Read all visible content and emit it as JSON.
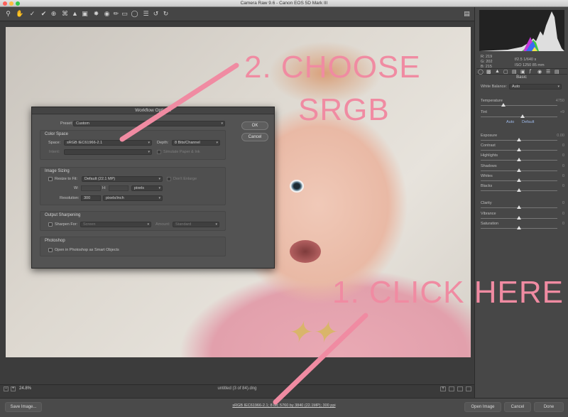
{
  "window": {
    "title": "Camera Raw 9.6  -  Canon EOS 5D Mark III"
  },
  "toolbar": {
    "tools": [
      "zoom-icon",
      "hand-icon",
      "white-balance-icon",
      "color-sampler-icon",
      "target-adjust-icon",
      "crop-icon",
      "straighten-icon",
      "transform-icon",
      "spot-removal-icon",
      "red-eye-icon",
      "adjustment-brush-icon",
      "graduated-filter-icon",
      "radial-filter-icon",
      "preferences-icon",
      "rotate-ccw-icon",
      "rotate-cw-icon"
    ]
  },
  "histogram_readout": {
    "r": "R:  219",
    "g": "G:  202",
    "b": "B:  215",
    "aperture_shutter": "f/2.5    1/640 s",
    "iso_focal": "ISO 1250   85 mm"
  },
  "basic_panel": {
    "title": "Basic",
    "white_balance_label": "White Balance:",
    "white_balance_value": "Auto",
    "auto_link": "Auto",
    "default_link": "Default",
    "sliders": [
      {
        "name": "temperature",
        "label": "Temperature",
        "value": "4750",
        "pos": 0.3
      },
      {
        "name": "tint",
        "label": "Tint",
        "value": "+9",
        "pos": 0.55
      },
      {
        "name": "exposure",
        "label": "Exposure",
        "value": "0.00",
        "pos": 0.5
      },
      {
        "name": "contrast",
        "label": "Contrast",
        "value": "0",
        "pos": 0.5
      },
      {
        "name": "highlights",
        "label": "Highlights",
        "value": "0",
        "pos": 0.5
      },
      {
        "name": "shadows",
        "label": "Shadows",
        "value": "0",
        "pos": 0.5
      },
      {
        "name": "whites",
        "label": "Whites",
        "value": "0",
        "pos": 0.5
      },
      {
        "name": "blacks",
        "label": "Blacks",
        "value": "0",
        "pos": 0.5
      },
      {
        "name": "clarity",
        "label": "Clarity",
        "value": "0",
        "pos": 0.5
      },
      {
        "name": "vibrance",
        "label": "Vibrance",
        "value": "0",
        "pos": 0.5
      },
      {
        "name": "saturation",
        "label": "Saturation",
        "value": "0",
        "pos": 0.5
      }
    ]
  },
  "statusbar": {
    "zoom": "24.8%",
    "filename": "untitled (3 of 84).dng"
  },
  "bottombar": {
    "save_image": "Save Image...",
    "workflow_link": "sRGB IEC61966-2.1; 8 bit; 5760 by 3840 (22.1MP); 300 ppi",
    "open_image": "Open Image",
    "cancel": "Cancel",
    "done": "Done"
  },
  "workflow_dialog": {
    "title": "Workflow Options",
    "preset_label": "Preset:",
    "preset_value": "Custom",
    "ok": "OK",
    "cancel": "Cancel",
    "color_space": {
      "title": "Color Space",
      "space_label": "Space:",
      "space_value": "sRGB IEC61966-2.1",
      "depth_label": "Depth:",
      "depth_value": "8 Bits/Channel",
      "intent_label": "Intent:",
      "simulate_label": "Simulate Paper & Ink"
    },
    "image_sizing": {
      "title": "Image Sizing",
      "resize_label": "Resize to Fit:",
      "resize_value": "Default  (22.1 MP)",
      "dont_enlarge": "Don't Enlarge",
      "w_label": "W:",
      "h_label": "H:",
      "units_value": "pixels",
      "resolution_label": "Resolution:",
      "resolution_value": "300",
      "resolution_units": "pixels/inch"
    },
    "output_sharpening": {
      "title": "Output Sharpening",
      "sharpen_label": "Sharpen For:",
      "sharpen_value": "Screen",
      "amount_label": "Amount:",
      "amount_value": "Standard"
    },
    "photoshop": {
      "title": "Photoshop",
      "smart_objects_label": "Open in Photoshop as Smart Objects"
    }
  },
  "annotations": {
    "step2_line1": "2. CHOOSE",
    "step2_line2": "SRGB",
    "step1": "1. CLICK HERE",
    "color": "#f08ba2"
  }
}
